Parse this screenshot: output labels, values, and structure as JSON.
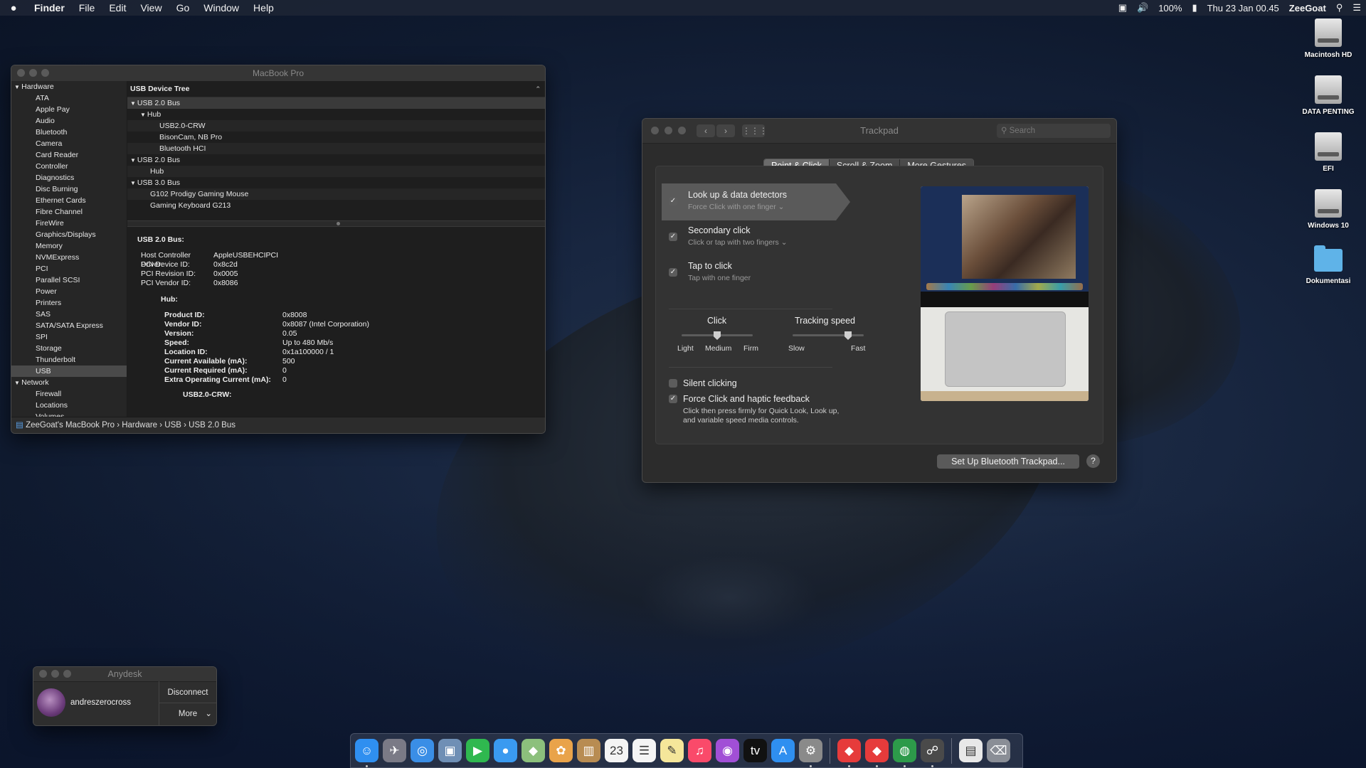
{
  "menubar": {
    "apple": "",
    "app": "Finder",
    "items": [
      "File",
      "Edit",
      "View",
      "Go",
      "Window",
      "Help"
    ],
    "battery": "100%",
    "datetime": "Thu 23 Jan  00.45",
    "user": "ZeeGoat"
  },
  "desktop_icons": [
    {
      "label": "Macintosh HD",
      "icon": "hard-drive-icon"
    },
    {
      "label": "DATA PENTING",
      "icon": "hard-drive-icon"
    },
    {
      "label": "EFI",
      "icon": "hard-drive-icon"
    },
    {
      "label": "Windows 10",
      "icon": "hard-drive-icon"
    },
    {
      "label": "Dokumentasi",
      "icon": "folder-icon"
    }
  ],
  "sysinfo": {
    "title": "MacBook Pro",
    "sidebar": [
      {
        "label": "Hardware",
        "group": true
      },
      {
        "label": "ATA"
      },
      {
        "label": "Apple Pay"
      },
      {
        "label": "Audio"
      },
      {
        "label": "Bluetooth"
      },
      {
        "label": "Camera"
      },
      {
        "label": "Card Reader"
      },
      {
        "label": "Controller"
      },
      {
        "label": "Diagnostics"
      },
      {
        "label": "Disc Burning"
      },
      {
        "label": "Ethernet Cards"
      },
      {
        "label": "Fibre Channel"
      },
      {
        "label": "FireWire"
      },
      {
        "label": "Graphics/Displays"
      },
      {
        "label": "Memory"
      },
      {
        "label": "NVMExpress"
      },
      {
        "label": "PCI"
      },
      {
        "label": "Parallel SCSI"
      },
      {
        "label": "Power"
      },
      {
        "label": "Printers"
      },
      {
        "label": "SAS"
      },
      {
        "label": "SATA/SATA Express"
      },
      {
        "label": "SPI"
      },
      {
        "label": "Storage"
      },
      {
        "label": "Thunderbolt"
      },
      {
        "label": "USB",
        "selected": true
      },
      {
        "label": "Network",
        "group": true
      },
      {
        "label": "Firewall"
      },
      {
        "label": "Locations"
      },
      {
        "label": "Volumes"
      }
    ],
    "tree_header": "USB Device Tree",
    "tree": [
      {
        "label": "USB 2.0 Bus",
        "level": 0,
        "arrow": true
      },
      {
        "label": "Hub",
        "level": 1,
        "arrow": true
      },
      {
        "label": "USB2.0-CRW",
        "level": 3
      },
      {
        "label": "BisonCam, NB Pro",
        "level": 3
      },
      {
        "label": "Bluetooth HCI",
        "level": 3
      },
      {
        "label": "USB 2.0 Bus",
        "level": 0,
        "arrow": true
      },
      {
        "label": "Hub",
        "level": 2
      },
      {
        "label": "USB 3.0 Bus",
        "level": 0,
        "arrow": true
      },
      {
        "label": "G102 Prodigy Gaming Mouse",
        "level": 2
      },
      {
        "label": "Gaming Keyboard G213",
        "level": 2
      }
    ],
    "detail_title": "USB 2.0 Bus:",
    "controller": [
      {
        "k": "Host Controller Driver:",
        "v": "AppleUSBEHCIPCI"
      },
      {
        "k": "PCI Device ID:",
        "v": "0x8c2d"
      },
      {
        "k": "PCI Revision ID:",
        "v": "0x0005"
      },
      {
        "k": "PCI Vendor ID:",
        "v": "0x8086"
      }
    ],
    "hub_title": "Hub:",
    "hub": [
      {
        "k": "Product ID:",
        "v": "0x8008"
      },
      {
        "k": "Vendor ID:",
        "v": "0x8087  (Intel Corporation)"
      },
      {
        "k": "Version:",
        "v": "0.05"
      },
      {
        "k": "Speed:",
        "v": "Up to 480 Mb/s"
      },
      {
        "k": "Location ID:",
        "v": "0x1a100000 / 1"
      },
      {
        "k": "Current Available (mA):",
        "v": "500"
      },
      {
        "k": "Current Required (mA):",
        "v": "0"
      },
      {
        "k": "Extra Operating Current (mA):",
        "v": "0"
      }
    ],
    "cut_off": "USB2.0-CRW:",
    "path": "ZeeGoat's MacBook Pro › Hardware  › USB  › USB 2.0 Bus"
  },
  "trackpad": {
    "title": "Trackpad",
    "search_placeholder": "Search",
    "tabs": [
      "Point & Click",
      "Scroll & Zoom",
      "More Gestures"
    ],
    "options": [
      {
        "title": "Look up & data detectors",
        "sub": "Force Click with one finger ⌄",
        "checked": true,
        "highlight": true
      },
      {
        "title": "Secondary click",
        "sub": "Click or tap with two fingers ⌄",
        "checked": true
      },
      {
        "title": "Tap to click",
        "sub": "Tap with one finger",
        "checked": true
      }
    ],
    "click_label": "Click",
    "click_ticks": [
      "Light",
      "Medium",
      "Firm"
    ],
    "click_value": 0.5,
    "speed_label": "Tracking speed",
    "speed_ticks": [
      "Slow",
      "Fast"
    ],
    "speed_value": 0.78,
    "silent": {
      "label": "Silent clicking",
      "checked": false
    },
    "force": {
      "label": "Force Click and haptic feedback",
      "checked": true,
      "desc1": "Click then press firmly for Quick Look, Look up,",
      "desc2": "and variable speed media controls."
    },
    "setup_button": "Set Up Bluetooth Trackpad...",
    "help": "?"
  },
  "anydesk": {
    "title": "Anydesk",
    "user": "andreszerocross",
    "disconnect": "Disconnect",
    "more": "More"
  },
  "dock": [
    {
      "name": "finder-icon",
      "glyph": "☺",
      "color": "#2f8ff0",
      "on": true
    },
    {
      "name": "launchpad-icon",
      "glyph": "✈",
      "color": "#7a7a86"
    },
    {
      "name": "safari-icon",
      "glyph": "◎",
      "color": "#3a8ee6"
    },
    {
      "name": "preview-icon",
      "glyph": "▣",
      "color": "#6f8fb5"
    },
    {
      "name": "facetime-icon",
      "glyph": "▶",
      "color": "#2fb84f"
    },
    {
      "name": "messages-icon",
      "glyph": "●",
      "color": "#3a9af0"
    },
    {
      "name": "maps-icon",
      "glyph": "◆",
      "color": "#8cc07c"
    },
    {
      "name": "photos-icon",
      "glyph": "✿",
      "color": "#e9a34a"
    },
    {
      "name": "notes-book-icon",
      "glyph": "▥",
      "color": "#b88c52"
    },
    {
      "name": "calendar-icon",
      "glyph": "23",
      "color": "#f4f4f4"
    },
    {
      "name": "reminders-icon",
      "glyph": "☰",
      "color": "#f4f4f4"
    },
    {
      "name": "notes-icon",
      "glyph": "✎",
      "color": "#f5e69a"
    },
    {
      "name": "music-icon",
      "glyph": "♫",
      "color": "#fa4a6a"
    },
    {
      "name": "podcasts-icon",
      "glyph": "◉",
      "color": "#a14fd6"
    },
    {
      "name": "tv-icon",
      "glyph": "tv",
      "color": "#111111"
    },
    {
      "name": "app-store-icon",
      "glyph": "A",
      "color": "#2f8ff0"
    },
    {
      "name": "system-preferences-icon",
      "glyph": "⚙",
      "color": "#8a8a8a",
      "on": true
    },
    {
      "name": "anydesk-icon",
      "glyph": "◆",
      "color": "#e63b3b",
      "on": true
    },
    {
      "name": "anydesk-alt-icon",
      "glyph": "◆",
      "color": "#e63b3b",
      "on": true
    },
    {
      "name": "globe-app-icon",
      "glyph": "◍",
      "color": "#2d9a4a",
      "on": true
    },
    {
      "name": "system-info-icon",
      "glyph": "☍",
      "color": "#4a4a4a",
      "on": true
    },
    {
      "name": "documents-stack-icon",
      "glyph": "▤",
      "color": "#e8e8e8"
    },
    {
      "name": "trash-icon",
      "glyph": "⌫",
      "color": "#8a8e96"
    }
  ]
}
